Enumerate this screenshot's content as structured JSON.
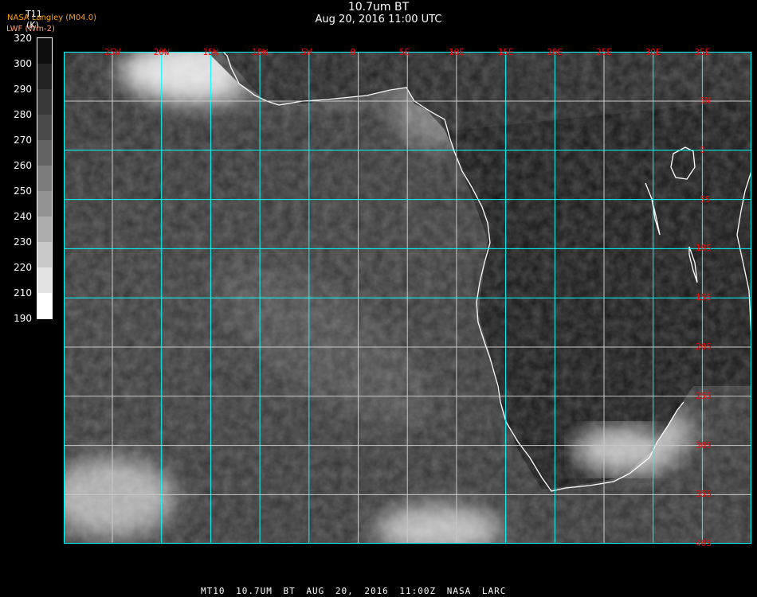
{
  "header": {
    "title": "10.7um BT",
    "subtitle": "Aug 20, 2016 11:00 UTC"
  },
  "legend": {
    "provider": "NASA Langley (M04.0)",
    "product": "LWF (Wm-2)",
    "variable": "T11",
    "unit": "(K)"
  },
  "colorbar": {
    "ticks": [
      "320",
      "300",
      "290",
      "280",
      "270",
      "260",
      "250",
      "240",
      "230",
      "220",
      "210",
      "190"
    ],
    "colors": [
      "#0e0e0e",
      "#222222",
      "#383838",
      "#4b4b4b",
      "#636363",
      "#7a7a7a",
      "#939393",
      "#adadad",
      "#c9c9c9",
      "#e3e3e3",
      "#ffffff"
    ]
  },
  "map": {
    "lon_labels": [
      "25W",
      "20W",
      "15W",
      "10W",
      "5W",
      "0",
      "5E",
      "10E",
      "15E",
      "20E",
      "25E",
      "30E",
      "35E"
    ],
    "lat_labels": [
      "5N",
      "0",
      "5S",
      "10S",
      "15S",
      "20S",
      "25S",
      "30S",
      "35S",
      "40S"
    ],
    "grid_color": "#00ffff",
    "coast_color": "#ffffff",
    "label_color": "#ff0000"
  },
  "footer": "MT10 10.7UM BT AUG 20, 2016 11:00Z NASA LARC"
}
